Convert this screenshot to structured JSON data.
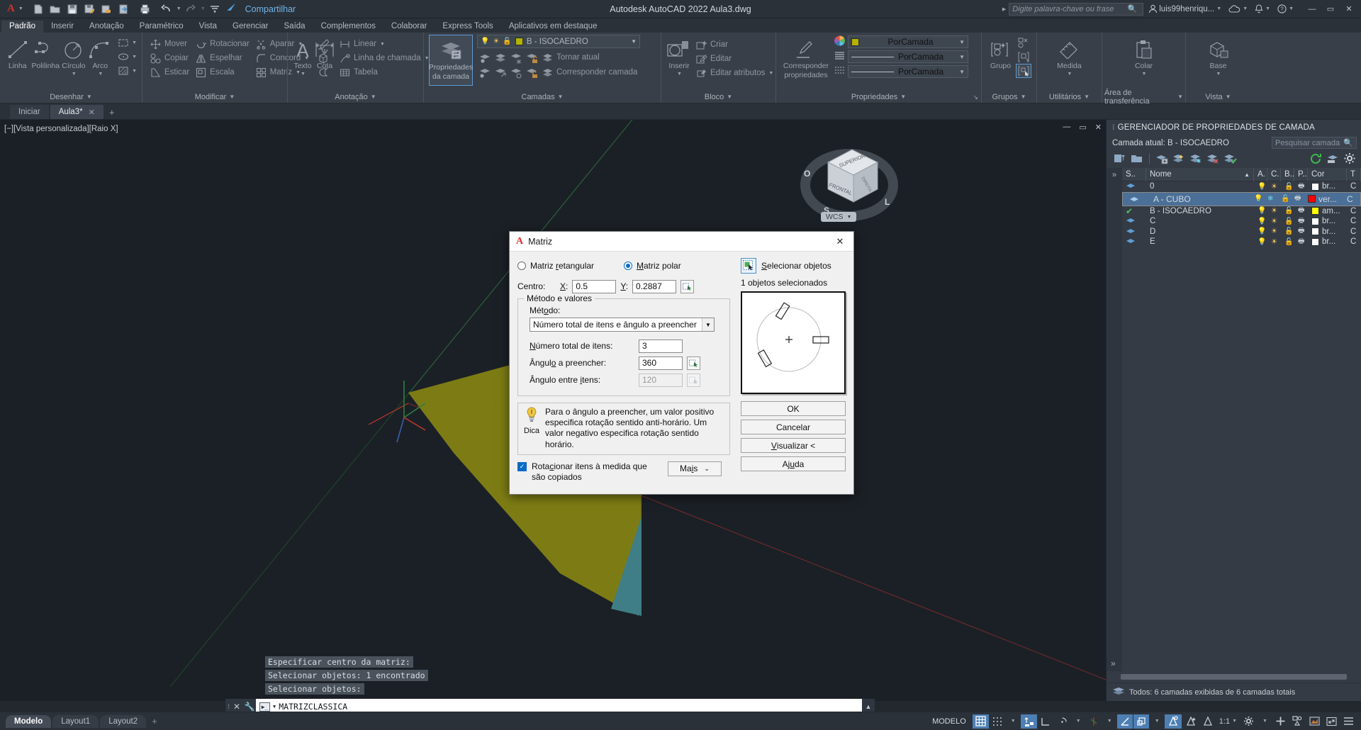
{
  "titlebar": {
    "app_logo": "A",
    "quick_access": [
      {
        "name": "new-file-icon",
        "label": "Novo"
      },
      {
        "name": "open-file-icon",
        "label": "Abrir"
      },
      {
        "name": "save-icon",
        "label": "Salvar"
      },
      {
        "name": "save-as-icon",
        "label": "Salvar como"
      },
      {
        "name": "save-to-web-icon",
        "label": "Salvar na Web"
      },
      {
        "name": "open-from-web-icon",
        "label": "Abrir da Web"
      },
      {
        "name": "plot-icon",
        "label": "Plotar"
      },
      {
        "name": "undo-icon",
        "label": "Desfazer"
      },
      {
        "name": "redo-icon",
        "label": "Refazer"
      },
      {
        "name": "qat-more-icon",
        "label": "Mais"
      }
    ],
    "share_label": "Compartilhar",
    "title": "Autodesk AutoCAD 2022   Aula3.dwg",
    "search_placeholder": "Digite palavra-chave ou frase",
    "user_name": "luis99henriqu...",
    "window_buttons": [
      "minimize",
      "maximize",
      "close"
    ]
  },
  "ribbon_tabs": [
    {
      "label": "Padrão",
      "active": true
    },
    {
      "label": "Inserir",
      "active": false
    },
    {
      "label": "Anotação",
      "active": false
    },
    {
      "label": "Paramétrico",
      "active": false
    },
    {
      "label": "Vista",
      "active": false
    },
    {
      "label": "Gerenciar",
      "active": false
    },
    {
      "label": "Saída",
      "active": false
    },
    {
      "label": "Complementos",
      "active": false
    },
    {
      "label": "Colaborar",
      "active": false
    },
    {
      "label": "Express Tools",
      "active": false
    },
    {
      "label": "Aplicativos em destaque",
      "active": false
    }
  ],
  "ribbon_panels": {
    "desenhar": {
      "title": "Desenhar",
      "big": [
        {
          "label": "Linha",
          "icon": "line-icon"
        },
        {
          "label": "Polilinha",
          "icon": "polyline-icon"
        },
        {
          "label": "Círculo",
          "icon": "circle-icon",
          "has_caret": true
        },
        {
          "label": "Arco",
          "icon": "arc-icon",
          "has_caret": true
        }
      ],
      "small_icons": [
        "rectangle-icon",
        "ellipse-icon",
        "hatch-icon"
      ]
    },
    "modificar": {
      "title": "Modificar",
      "items": [
        {
          "label": "Mover",
          "icon": "move-icon"
        },
        {
          "label": "Rotacionar",
          "icon": "rotate-icon"
        },
        {
          "label": "Aparar",
          "icon": "trim-icon",
          "has_caret": true
        },
        {
          "label": "Copiar",
          "icon": "copy-icon"
        },
        {
          "label": "Espelhar",
          "icon": "mirror-icon"
        },
        {
          "label": "Concord",
          "icon": "fillet-icon",
          "has_caret": true
        },
        {
          "label": "Esticar",
          "icon": "stretch-icon"
        },
        {
          "label": "Escala",
          "icon": "scale-icon"
        },
        {
          "label": "Matriz",
          "icon": "array-icon",
          "has_caret": true
        }
      ],
      "extra_icons": [
        "explode-icon",
        "3d-icon",
        "offset-icon"
      ]
    },
    "anotacao": {
      "title": "Anotação",
      "big": [
        {
          "label": "Texto",
          "icon": "text-icon",
          "has_caret": true
        },
        {
          "label": "Cota",
          "icon": "dimension-icon"
        }
      ],
      "items": [
        {
          "label": "Linear",
          "icon": "linear-dim-icon",
          "has_caret": true
        },
        {
          "label": "Linha de chamada",
          "icon": "leader-icon",
          "has_caret": true
        },
        {
          "label": "Tabela",
          "icon": "table-icon"
        }
      ]
    },
    "camadas": {
      "title": "Camadas",
      "big_label": "Propriedades\nda camada",
      "big_label_1": "Propriedades",
      "big_label_2": "da camada",
      "current_layer": "B - ISOCAEDRO",
      "current_layer_color": "#b5b300",
      "items": [
        {
          "label": "Tornar atual",
          "icon": "make-current-icon"
        },
        {
          "label": "Corresponder camada",
          "icon": "match-layer-icon"
        }
      ]
    },
    "bloco": {
      "title": "Bloco",
      "big_label": "Inserir",
      "items": [
        {
          "label": "Criar",
          "icon": "create-block-icon"
        },
        {
          "label": "Editar",
          "icon": "edit-block-icon"
        },
        {
          "label": "Editar atributos",
          "icon": "edit-attributes-icon",
          "has_caret": true
        }
      ]
    },
    "propriedades": {
      "title": "Propriedades",
      "big_label_1": "Corresponder",
      "big_label_2": "propriedades",
      "rows": [
        {
          "icon": "color-wheel-icon",
          "value": "PorCamada",
          "swatch": "#b5b300"
        },
        {
          "icon": "linetype-icon",
          "value": "PorCamada"
        },
        {
          "icon": "lineweight-icon",
          "value": "PorCamada"
        }
      ]
    },
    "grupos": {
      "title": "Grupos",
      "big_label": "Grupo"
    },
    "utilitarios": {
      "title": "Utilitários",
      "big_label": "Medida"
    },
    "transferencia": {
      "title": "Área de transferência",
      "big_label": "Colar"
    },
    "vista": {
      "title": "Vista",
      "big_label": "Base"
    }
  },
  "doc_tabs": [
    {
      "label": "Iniciar",
      "active": false,
      "closable": false
    },
    {
      "label": "Aula3*",
      "active": true,
      "closable": true
    }
  ],
  "doc_tab_add": "+",
  "canvas": {
    "viewport_label": "[−][Vista personalizada][Raio X]",
    "viewcube": {
      "top": "SUPERIOR",
      "front": "FRONTAL",
      "right": "DIREITA",
      "compass": [
        "O",
        "S",
        "L"
      ],
      "ucs_label": "WCS"
    }
  },
  "layer_palette": {
    "title": "GERENCIADOR DE PROPRIEDADES DE CAMADA",
    "current_layer_label": "Camada atual: B - ISOCAEDRO",
    "search_placeholder": "Pesquisar camada",
    "columns": [
      "S..",
      "Nome",
      "A.",
      "C.",
      "B..",
      "P..",
      "Cor",
      "T"
    ],
    "rows": [
      {
        "status": "layer",
        "name": "0",
        "on": "bulb",
        "freeze": "sun",
        "lock": "unlocked",
        "plot": "plot",
        "color_swatch": "#ffffff",
        "color": "br...",
        "selected": false,
        "current": false
      },
      {
        "status": "layer",
        "name": "A - CUBO",
        "on": "bulb",
        "freeze": "snow",
        "lock": "unlocked",
        "plot": "plot",
        "color_swatch": "#ff0000",
        "color": "ver...",
        "selected": true,
        "current": false
      },
      {
        "status": "current",
        "name": "B - ISOCAEDRO",
        "on": "bulb",
        "freeze": "sun",
        "lock": "unlocked",
        "plot": "plot",
        "color_swatch": "#ffff00",
        "color": "am...",
        "selected": false,
        "current": true
      },
      {
        "status": "layer",
        "name": "C",
        "on": "bulb",
        "freeze": "sun",
        "lock": "unlocked",
        "plot": "plot",
        "color_swatch": "#ffffff",
        "color": "br...",
        "selected": false,
        "current": false
      },
      {
        "status": "layer",
        "name": "D",
        "on": "bulb",
        "freeze": "sun",
        "lock": "unlocked",
        "plot": "plot",
        "color_swatch": "#ffffff",
        "color": "br...",
        "selected": false,
        "current": false
      },
      {
        "status": "layer",
        "name": "E",
        "on": "bulb",
        "freeze": "sun",
        "lock": "unlocked",
        "plot": "plot",
        "color_swatch": "#ffffff",
        "color": "br...",
        "selected": false,
        "current": false
      }
    ],
    "footer": "Todos: 6 camadas exibidas de 6 camadas totais"
  },
  "command_history": [
    "Especificar centro da matriz:",
    "Selecionar objetos: 1 encontrado",
    "Selecionar objetos:"
  ],
  "command_input": "MATRIZCLASSICA",
  "layout_tabs": [
    {
      "label": "Modelo",
      "active": true
    },
    {
      "label": "Layout1",
      "active": false
    },
    {
      "label": "Layout2",
      "active": false
    }
  ],
  "layout_add": "+",
  "status_bar": {
    "model_label": "MODELO",
    "scale": "1:1",
    "toggles": [
      {
        "name": "grid-toggle",
        "on": true
      },
      {
        "name": "snap-toggle",
        "on": false,
        "caret": true
      },
      {
        "name": "infer-constraints-toggle",
        "on": true
      },
      {
        "name": "ortho-toggle",
        "on": false
      },
      {
        "name": "polar-tracking-toggle",
        "on": false,
        "caret": true
      },
      {
        "name": "object-snap-toggle",
        "on": false,
        "caret": true
      },
      {
        "name": "3d-object-snap-toggle",
        "on": true
      },
      {
        "name": "object-snap-tracking-toggle",
        "on": true
      },
      {
        "name": "dynamic-ucs-toggle",
        "on": true
      },
      {
        "name": "selection-cycling-toggle",
        "on": false
      },
      {
        "name": "annotation-visibility-toggle",
        "on": false
      },
      {
        "name": "workspace-toggle",
        "on": false,
        "caret": true
      },
      {
        "name": "hardware-accel-toggle",
        "on": false
      },
      {
        "name": "isolate-objects-toggle",
        "on": false
      },
      {
        "name": "fullscreen-toggle",
        "on": false
      },
      {
        "name": "customization-toggle",
        "on": false
      }
    ]
  },
  "dialog": {
    "title": "Matriz",
    "logo": "A",
    "close": "✕",
    "mode_rectangular": "Matriz retangular",
    "mode_polar": "Matriz polar",
    "mode_selected": "polar",
    "center_label": "Centro:",
    "x_label": "X:",
    "x_value": "0.5",
    "y_label": "Y:",
    "y_value": "0.2887",
    "group_title": "Método e valores",
    "method_label": "Método:",
    "method_value": "Número total de itens e ângulo a preencher",
    "total_items_label": "Número total de itens:",
    "total_items_value": "3",
    "fill_angle_label": "Ângulo a preencher:",
    "fill_angle_value": "360",
    "between_angle_label": "Ângulo entre itens:",
    "between_angle_value": "120",
    "hint_label": "Dica",
    "hint_text": "Para o ângulo a preencher, um valor positivo especifica rotação sentido anti-horário. Um valor negativo especifica rotação sentido horário.",
    "rotate_checkbox_label": "Rotacionar itens à medida que são copiados",
    "rotate_checked": true,
    "more_button": "Mais",
    "select_objects_label": "Selecionar objetos",
    "selected_count": "1 objetos selecionados",
    "buttons": {
      "ok": "OK",
      "cancel": "Cancelar",
      "preview": "Visualizar <",
      "help": "Ajuda"
    }
  }
}
